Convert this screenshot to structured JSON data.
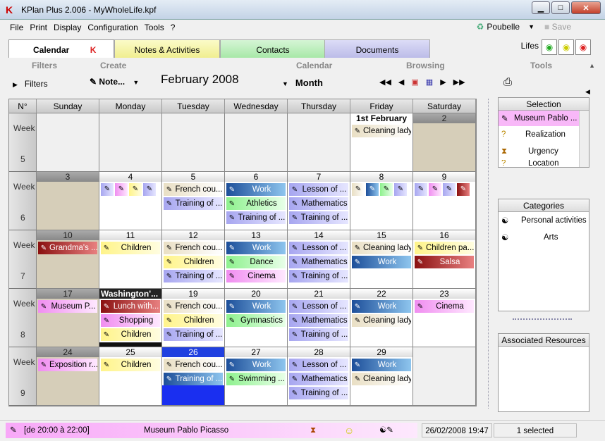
{
  "window": {
    "title": "KPlan Plus 2.006 - MyWholeLife.kpf",
    "min": "▁",
    "max": "□",
    "close": "✕"
  },
  "menu": [
    "File",
    "Print",
    "Display",
    "Configuration",
    "Tools",
    "?"
  ],
  "top_right": {
    "poubelle": "Poubelle",
    "save": "Save"
  },
  "tabs": [
    "Calendar",
    "Notes & Activities",
    "Contacts",
    "Documents"
  ],
  "lifes_label": "Lifes",
  "toolbar": {
    "filters_hdr": "Filters",
    "create_hdr": "Create",
    "calendar_hdr": "Calendar",
    "browsing_hdr": "Browsing",
    "tools_hdr": "Tools",
    "filters_btn": "Filters",
    "note_btn": "Note...",
    "month_title": "February 2008",
    "view_select": "Month"
  },
  "grid": {
    "headers": [
      "N°",
      "Sunday",
      "Monday",
      "Tuesday",
      "Wednesday",
      "Thursday",
      "Friday",
      "Saturday"
    ],
    "week_word": "Week",
    "weeks": [
      "5",
      "6",
      "7",
      "8",
      "9"
    ],
    "days": [
      [
        "",
        "",
        "",
        "",
        "",
        "1st February",
        "2"
      ],
      [
        "3",
        "4",
        "5",
        "6",
        "7",
        "8",
        "9"
      ],
      [
        "10",
        "11",
        "12",
        "13",
        "14",
        "15",
        "16"
      ],
      [
        "17",
        "Washington'...",
        "19",
        "20",
        "21",
        "22",
        "23"
      ],
      [
        "24",
        "25",
        "26",
        "27",
        "28",
        "29",
        ""
      ]
    ],
    "events": [
      [
        [],
        [],
        [],
        [],
        [],
        [
          [
            "beige",
            "Cleaning lady"
          ]
        ],
        []
      ],
      [
        [],
        [
          [
            "lav",
            ""
          ],
          [
            "pink",
            ""
          ],
          [
            "yel",
            ""
          ],
          [
            "lav",
            ""
          ]
        ],
        [
          [
            "beige",
            "French cou..."
          ],
          [
            "lav",
            "Training of ..."
          ]
        ],
        [
          [
            "blue",
            "Work"
          ],
          [
            "grn",
            "Athletics"
          ],
          [
            "lav",
            "Training of ..."
          ]
        ],
        [
          [
            "lav",
            "Lesson of ..."
          ],
          [
            "lav",
            "Mathematics"
          ],
          [
            "lav",
            "Training of ..."
          ]
        ],
        [
          [
            "beige",
            ""
          ],
          [
            "blue",
            ""
          ],
          [
            "grn",
            ""
          ],
          [
            "lav",
            ""
          ]
        ],
        [
          [
            "lav",
            ""
          ],
          [
            "pink",
            ""
          ],
          [
            "lav",
            ""
          ],
          [
            "red",
            ""
          ]
        ]
      ],
      [
        [
          [
            "red",
            "Grandma's ..."
          ]
        ],
        [
          [
            "yel",
            "Children"
          ]
        ],
        [
          [
            "beige",
            "French cou..."
          ],
          [
            "yel",
            "Children"
          ],
          [
            "lav",
            "Training of ..."
          ]
        ],
        [
          [
            "blue",
            "Work"
          ],
          [
            "grn",
            "Dance"
          ],
          [
            "pink",
            "Cinema"
          ]
        ],
        [
          [
            "lav",
            "Lesson of ..."
          ],
          [
            "lav",
            "Mathematics"
          ],
          [
            "lav",
            "Training of ..."
          ]
        ],
        [
          [
            "beige",
            "Cleaning lady"
          ],
          [
            "blue",
            "Work"
          ]
        ],
        [
          [
            "yel",
            "Children pa..."
          ],
          [
            "red",
            "Salsa"
          ]
        ]
      ],
      [
        [
          [
            "pink",
            "Museum P..."
          ]
        ],
        [
          [
            "red",
            "Lunch with..."
          ],
          [
            "pink",
            "Shopping"
          ],
          [
            "yel",
            "Children"
          ]
        ],
        [
          [
            "beige",
            "French cou..."
          ],
          [
            "yel",
            "Children"
          ],
          [
            "lav",
            "Training of ..."
          ]
        ],
        [
          [
            "blue",
            "Work"
          ],
          [
            "grn",
            "Gymnastics"
          ]
        ],
        [
          [
            "lav",
            "Lesson of ..."
          ],
          [
            "lav",
            "Mathematics"
          ],
          [
            "lav",
            "Training of ..."
          ]
        ],
        [
          [
            "blue",
            "Work"
          ],
          [
            "beige",
            "Cleaning lady"
          ]
        ],
        [
          [
            "pink",
            "Cinema"
          ]
        ]
      ],
      [
        [
          [
            "pink",
            "Exposition r..."
          ]
        ],
        [
          [
            "yel",
            "Children"
          ]
        ],
        [
          [
            "beige",
            "French cou..."
          ],
          [
            "blue",
            "Training of ..."
          ]
        ],
        [
          [
            "blue",
            "Work"
          ],
          [
            "grn",
            "Swimming ..."
          ]
        ],
        [
          [
            "lav",
            "Lesson of ..."
          ],
          [
            "lav",
            "Mathematics"
          ],
          [
            "lav",
            "Training of ..."
          ]
        ],
        [
          [
            "blue",
            "Work"
          ],
          [
            "beige",
            "Cleaning lady"
          ]
        ],
        []
      ]
    ]
  },
  "selection": {
    "title": "Selection",
    "items": [
      "Museum Pablo ...",
      "Realization",
      "Urgency",
      "Location"
    ]
  },
  "categories": {
    "title": "Categories",
    "items": [
      "Personal activities",
      "Arts"
    ]
  },
  "resources": {
    "title": "Associated Resources"
  },
  "status": {
    "time": "[de 20:00 à 22:00]",
    "event": "Museum Pablo Picasso",
    "datetime": "26/02/2008 19:47",
    "selected": "1 selected"
  }
}
